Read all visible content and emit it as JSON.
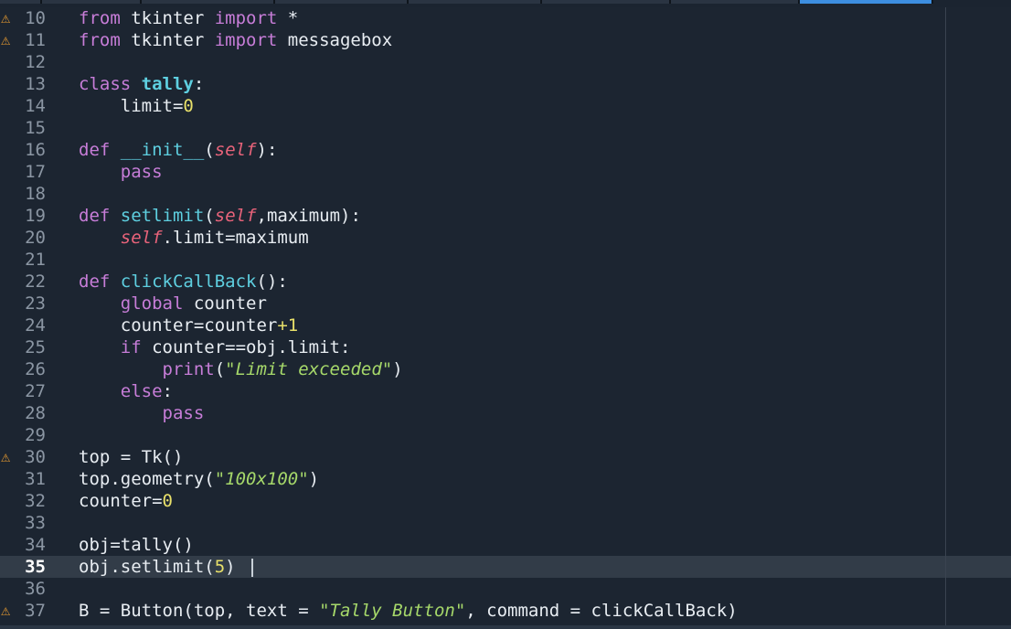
{
  "editor": {
    "language": "python",
    "current_line": "35",
    "lines": [
      {
        "num": "10",
        "warning": true,
        "text": "from tkinter import *"
      },
      {
        "num": "11",
        "warning": true,
        "text": "from tkinter import messagebox"
      },
      {
        "num": "12",
        "warning": false,
        "text": ""
      },
      {
        "num": "13",
        "warning": false,
        "text": "class tally:"
      },
      {
        "num": "14",
        "warning": false,
        "text": "    limit=0"
      },
      {
        "num": "15",
        "warning": false,
        "text": ""
      },
      {
        "num": "16",
        "warning": false,
        "text": "def __init__(self):"
      },
      {
        "num": "17",
        "warning": false,
        "text": "    pass"
      },
      {
        "num": "18",
        "warning": false,
        "text": ""
      },
      {
        "num": "19",
        "warning": false,
        "text": "def setlimit(self,maximum):"
      },
      {
        "num": "20",
        "warning": false,
        "text": "    self.limit=maximum"
      },
      {
        "num": "21",
        "warning": false,
        "text": ""
      },
      {
        "num": "22",
        "warning": false,
        "text": "def clickCallBack():"
      },
      {
        "num": "23",
        "warning": false,
        "text": "    global counter"
      },
      {
        "num": "24",
        "warning": false,
        "text": "    counter=counter+1"
      },
      {
        "num": "25",
        "warning": false,
        "text": "    if counter==obj.limit:"
      },
      {
        "num": "26",
        "warning": false,
        "text": "        print(\"Limit exceeded\")"
      },
      {
        "num": "27",
        "warning": false,
        "text": "    else:"
      },
      {
        "num": "28",
        "warning": false,
        "text": "        pass"
      },
      {
        "num": "29",
        "warning": false,
        "text": ""
      },
      {
        "num": "30",
        "warning": true,
        "text": "top = Tk()"
      },
      {
        "num": "31",
        "warning": false,
        "text": "top.geometry(\"100x100\")"
      },
      {
        "num": "32",
        "warning": false,
        "text": "counter=0"
      },
      {
        "num": "33",
        "warning": false,
        "text": ""
      },
      {
        "num": "34",
        "warning": false,
        "text": "obj=tally()"
      },
      {
        "num": "35",
        "warning": false,
        "text": "obj.setlimit(5) "
      },
      {
        "num": "36",
        "warning": false,
        "text": ""
      },
      {
        "num": "37",
        "warning": true,
        "text": "B = Button(top, text = \"Tally Button\", command = clickCallBack)"
      }
    ]
  },
  "icons": {
    "warning": "warning-triangle-icon"
  },
  "colors": {
    "background": "#1c2531",
    "keyword": "#c77dd8",
    "function": "#5ecfe0",
    "number": "#e8e06a",
    "self": "#e8637a",
    "string": "#a6d86a",
    "warning": "#f0a030",
    "tab_active": "#3d8ee0"
  }
}
